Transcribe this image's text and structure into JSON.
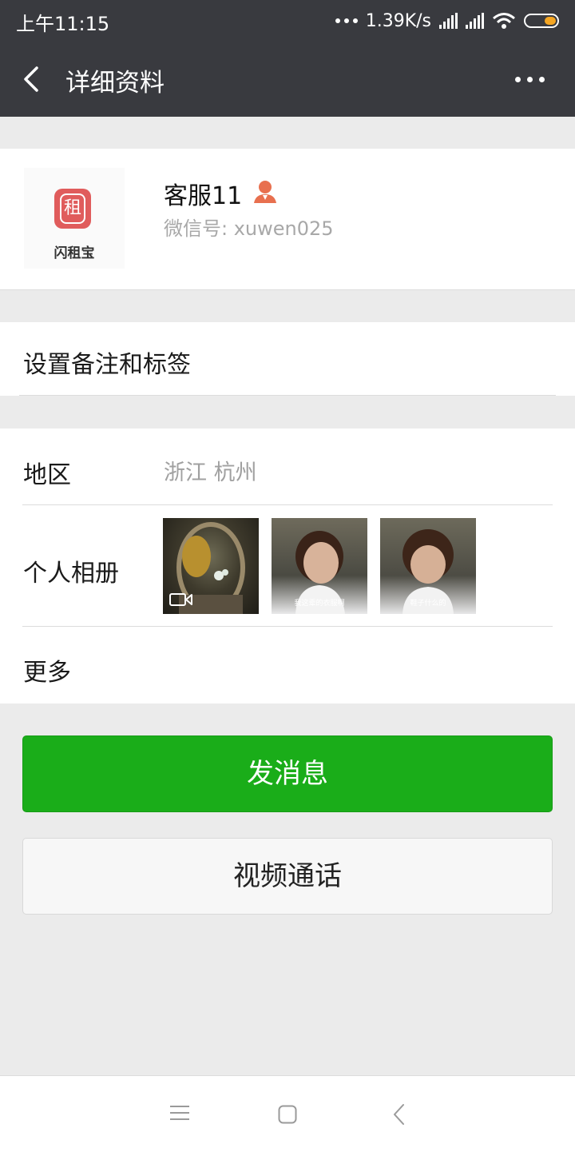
{
  "status_bar": {
    "time": "上午11:15",
    "network_speed": "1.39K/s",
    "battery_color": "#f5a623"
  },
  "header": {
    "title": "详细资料",
    "back_icon": "chevron-left-icon",
    "more_icon": "more-dots-icon"
  },
  "profile": {
    "name": "客服11",
    "wechat_id": "微信号: xuwen025",
    "avatar_brand": "闪租宝",
    "avatar_glyph": "租",
    "badge_icon": "person-icon",
    "badge_color": "#e8704f"
  },
  "remark": {
    "label": "设置备注和标签"
  },
  "info": {
    "region_label": "地区",
    "region_value": "浙江  杭州",
    "album_label": "个人相册",
    "album": [
      {
        "caption": "",
        "video": true
      },
      {
        "caption": "我这辈的衣服啊",
        "video": false
      },
      {
        "caption": "鞋子什么的",
        "video": false
      }
    ],
    "more_label": "更多"
  },
  "actions": {
    "send_message": "发消息",
    "video_call": "视频通话",
    "primary_color": "#1aad19"
  },
  "nav": {
    "menu_icon": "menu-icon",
    "home_icon": "home-icon",
    "back_icon": "back-icon"
  }
}
